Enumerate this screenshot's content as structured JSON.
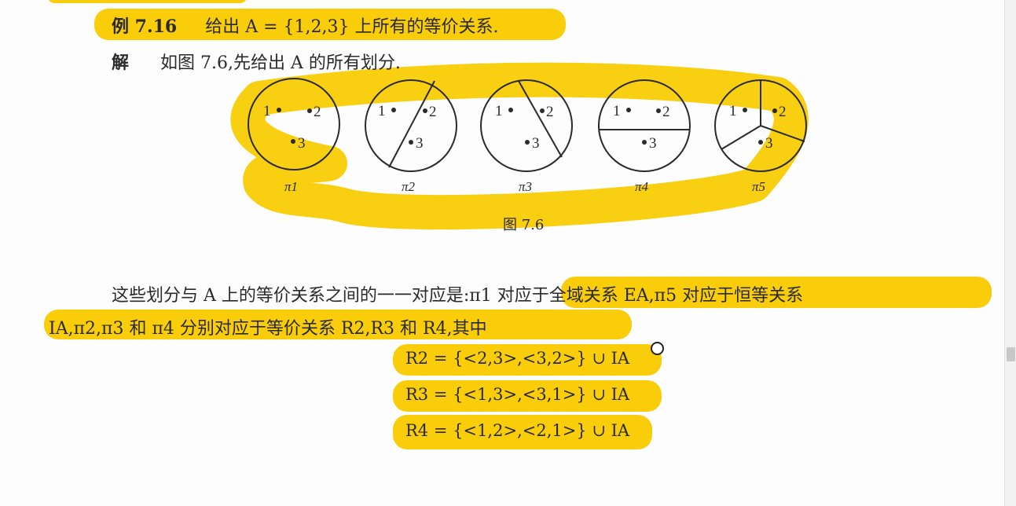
{
  "example": {
    "label": "例 7.16",
    "text": "给出 A = {1,2,3} 上所有的等价关系."
  },
  "solution": {
    "label": "解",
    "text": "如图 7.6,先给出 A 的所有划分."
  },
  "figure": {
    "caption": "图 7.6",
    "points": [
      "1",
      "2",
      "3"
    ],
    "partitions": [
      {
        "label": "π1",
        "blocks": "{1,2,3}"
      },
      {
        "label": "π2",
        "blocks": "{1},{2,3}"
      },
      {
        "label": "π3",
        "blocks": "{2},{1,3}"
      },
      {
        "label": "π4",
        "blocks": "{3},{1,2}"
      },
      {
        "label": "π5",
        "blocks": "{1},{2},{3}"
      }
    ]
  },
  "paragraph": {
    "line1": "这些划分与 A 上的等价关系之间的一一对应是:π1 对应于全域关系 EA,π5 对应于恒等关系",
    "line2": "IA,π2,π3 和 π4 分别对应于等价关系 R2,R3 和 R4,其中"
  },
  "formulas": [
    "R2 = {<2,3>,<3,2>} ∪ IA",
    "R3 = {<1,3>,<3,1>} ∪ IA",
    "R4 = {<1,2>,<2,1>} ∪ IA"
  ],
  "colors": {
    "highlight": "#f9cd0a",
    "ink": "#2a2a2a"
  }
}
